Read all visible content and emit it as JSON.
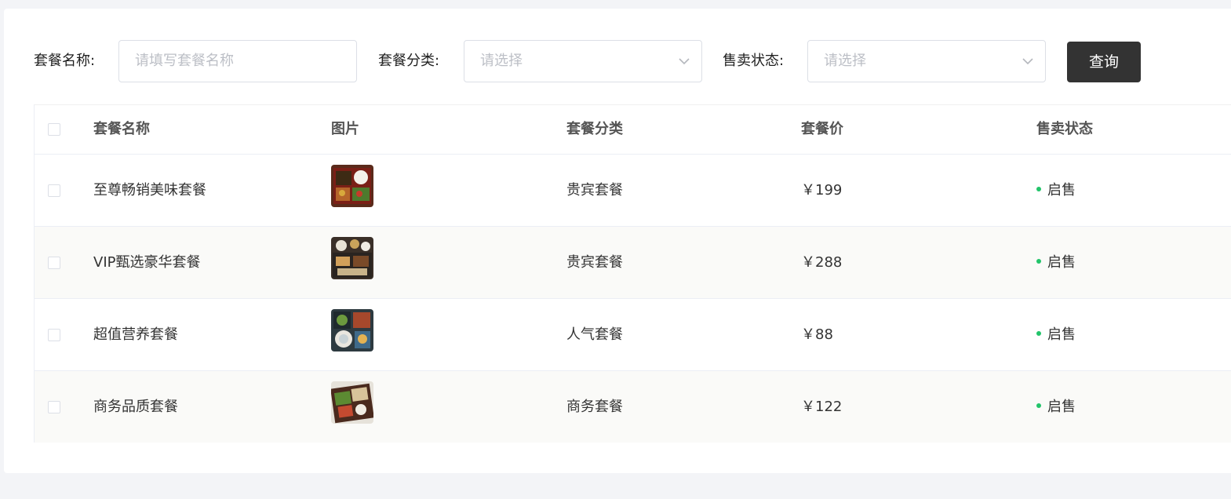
{
  "filters": {
    "name_label": "套餐名称:",
    "name_placeholder": "请填写套餐名称",
    "category_label": "套餐分类:",
    "category_placeholder": "请选择",
    "status_label": "售卖状态:",
    "status_placeholder": "请选择",
    "query_button": "查询"
  },
  "table": {
    "headers": {
      "name": "套餐名称",
      "image": "图片",
      "category": "套餐分类",
      "price": "套餐价",
      "status": "售卖状态"
    },
    "rows": [
      {
        "name": "至尊畅销美味套餐",
        "image": "bento-food-image",
        "category": "贵宾套餐",
        "price": "￥199",
        "status": "启售"
      },
      {
        "name": "VIP甄选豪华套餐",
        "image": "bento-food-image",
        "category": "贵宾套餐",
        "price": "￥288",
        "status": "启售"
      },
      {
        "name": "超值营养套餐",
        "image": "bento-food-image",
        "category": "人气套餐",
        "price": "￥88",
        "status": "启售"
      },
      {
        "name": "商务品质套餐",
        "image": "bento-food-image",
        "category": "商务套餐",
        "price": "￥122",
        "status": "启售"
      }
    ]
  },
  "colors": {
    "primary_button": "#333333",
    "status_dot": "#22c46a"
  }
}
